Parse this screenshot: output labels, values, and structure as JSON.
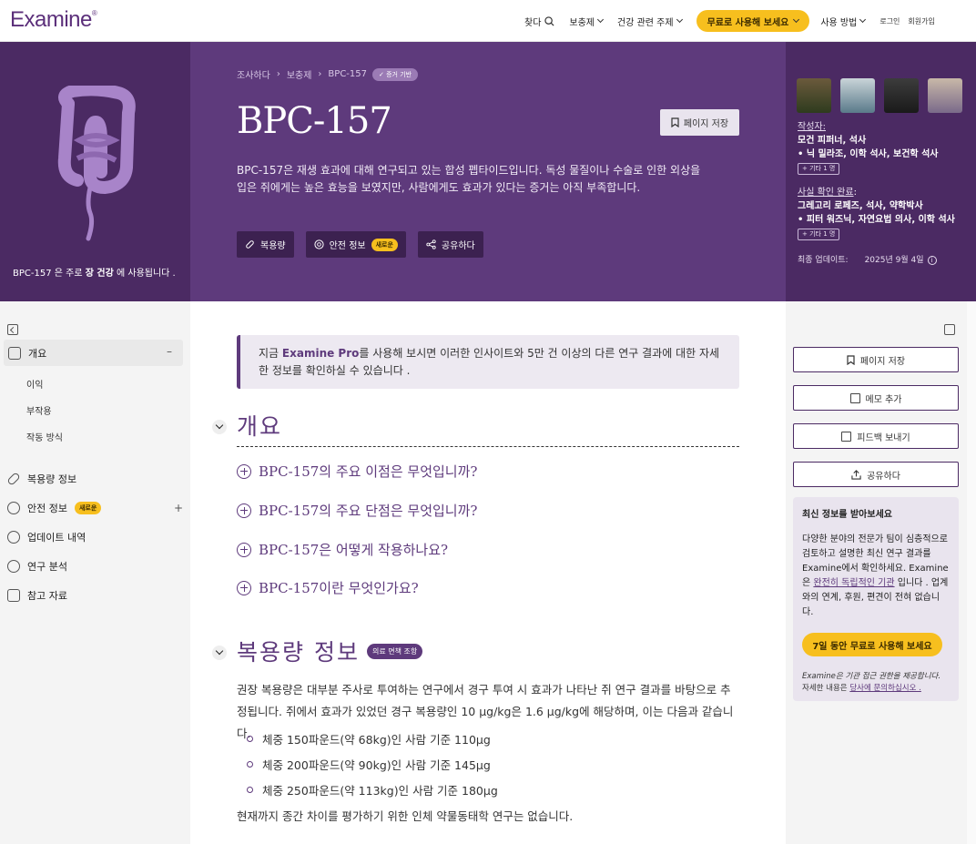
{
  "nav": {
    "logo": "Examine",
    "logo_mark": "®",
    "search": "찾다",
    "supplements": "보충제",
    "health_topics": "건강 관련 주제",
    "cta": "무료로 사용해 보세요",
    "how_to_use": "사용 방법",
    "login": "로그인",
    "signup": "회원가입"
  },
  "hero": {
    "caption_pre": "BPC-157 은 주로",
    "caption_bold": "장 건강",
    "caption_post": "에 사용됩니다 .",
    "breadcrumbs": [
      "조사하다",
      "보충제",
      "BPC-157"
    ],
    "evidence_badge": "증거 기반",
    "title": "BPC-157",
    "save_label": "페이지 저장",
    "description": "BPC-157은 재생 효과에 대해 연구되고 있는 합성 펩타이드입니다. 독성 물질이나 수술로 인한 외상을 입은 쥐에게는 높은 효능을 보였지만, 사람에게도 효과가 있다는 증거는 아직 부족합니다.",
    "pills": {
      "dosage": "복용량",
      "safety": "안전 정보",
      "safety_badge": "새로운",
      "share": "공유하다"
    }
  },
  "authors": {
    "written_label": "작성자:",
    "written_names": "모건 피퍼너, 석사",
    "written_names2": "• 닉 밀라조, 이학 석사, 보건학 석사",
    "written_more": "+ 기타 1 명",
    "factcheck_label": "사실 확인 완료",
    "factcheck_names": "그레고리 로페즈, 석사, 약학박사",
    "factcheck_names2": "• 피터 워즈닉, 자연요법 의사, 이학 석사",
    "factcheck_more": "+ 기타 1 명",
    "updated_label": "최종 업데이트:",
    "updated_date": "2025년 9월 4일"
  },
  "toc": {
    "overview": "개요",
    "benefits": "이익",
    "side_effects": "부작용",
    "mechanism": "작동 방식",
    "dosage": "복용량 정보",
    "safety": "안전 정보",
    "safety_badge": "새로운",
    "updates": "업데이트 내역",
    "research": "연구 분석",
    "references": "참고 자료"
  },
  "main": {
    "promo_pre": "지금",
    "promo_brand": "Examine Pro",
    "promo_post": "를 사용해 보시면 이러한 인사이트와 5만 건 이상의 다른 연구 결과에 대한 자세한 정보를 확인하실 수 있습니다 .",
    "overview_heading": "개요",
    "faqs": [
      "BPC-157의 주요 이점은 무엇입니까?",
      "BPC-157의 주요 단점은 무엇입니까?",
      "BPC-157은 어떻게 작용하나요?",
      "BPC-157이란 무엇인가요?"
    ],
    "dosage_heading": "복용량 정보",
    "disclaimer_badge": "의료 면책 조항",
    "dosage_text": "권장 복용량은 대부분 주사로 투여하는 연구에서 경구 투여 시 효과가 나타난 쥐 연구 결과를 바탕으로 추정됩니다. 쥐에서 효과가 있었던 경구 복용량인 10 μg/kg은 1.6 μg/kg에 해당하며, 이는 다음과 같습니다.",
    "dosage_list": [
      "체중 150파운드(약 68kg)인 사람 기준 110μg",
      "체중 200파운드(약 90kg)인 사람 기준 145μg",
      "체중 250파운드(약 113kg)인 사람 기준 180μg"
    ],
    "dosage_footer": "현재까지 종간 차이를 평가하기 위한 인체 약물동태학 연구는 없습니다."
  },
  "sidebar": {
    "save": "페이지 저장",
    "note": "메모 추가",
    "feedback": "피드백 보내기",
    "share": "공유하다",
    "news_title": "최신 정보를 받아보세요",
    "news_text_pre": "다양한 분야의 전문가 팀이 심층적으로 검토하고 설명한 최신 연구 결과를 Examine에서 확인하세요. Examine은",
    "news_link": "완전히 독립적인 기관",
    "news_text_post": "입니다 . 업계와의 연계, 후원, 편견이 전혀 없습니다.",
    "trial_button": "7일 동안 무료로 사용해 보세요",
    "fine_italic": "Examine은 기관 접근 권한을 제공합니다.",
    "fine_pre": "자세한 내용은",
    "fine_link": "당사에 문의하십시오 ."
  },
  "colors": {
    "brand_purple": "#5e3a7c",
    "dark_purple": "#4b2a63",
    "accent_yellow": "#f7bf1e"
  }
}
